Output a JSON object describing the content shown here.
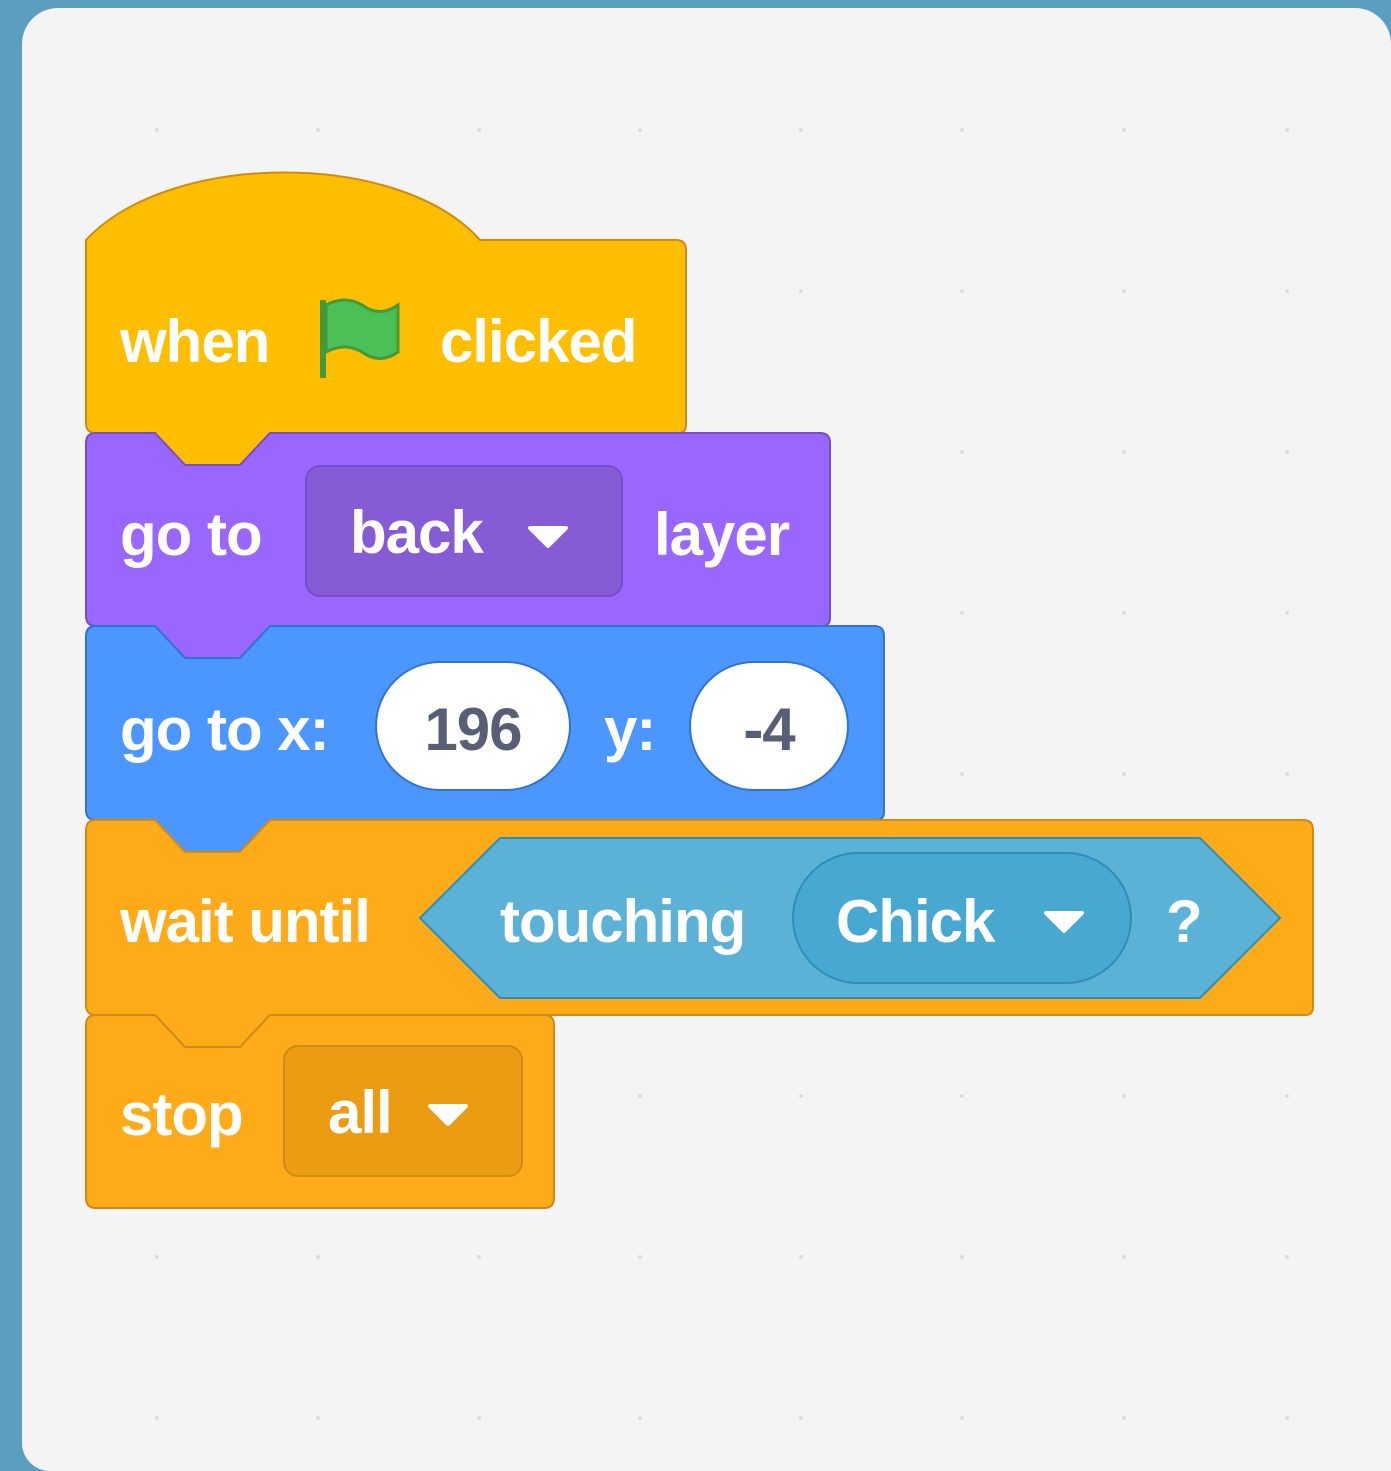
{
  "script": {
    "hat": {
      "prefix": "when",
      "suffix": "clicked",
      "icon": "green-flag-icon",
      "color": "#ffbf00"
    },
    "layer": {
      "prefix": "go to",
      "dropdown": "back",
      "suffix": "layer",
      "color": "#9966ff"
    },
    "goto_xy": {
      "prefix": "go to x:",
      "x_value": "196",
      "y_label": "y:",
      "y_value": "-4",
      "color": "#4c97ff"
    },
    "wait_until": {
      "prefix": "wait until",
      "condition_label": "touching",
      "condition_dropdown": "Chick",
      "condition_suffix": "?",
      "color": "#ffab19",
      "sensing_color": "#5cb1d6"
    },
    "stop": {
      "prefix": "stop",
      "dropdown": "all",
      "color": "#ffab19"
    }
  },
  "icons": {
    "dropdown": "caret-down-icon"
  }
}
